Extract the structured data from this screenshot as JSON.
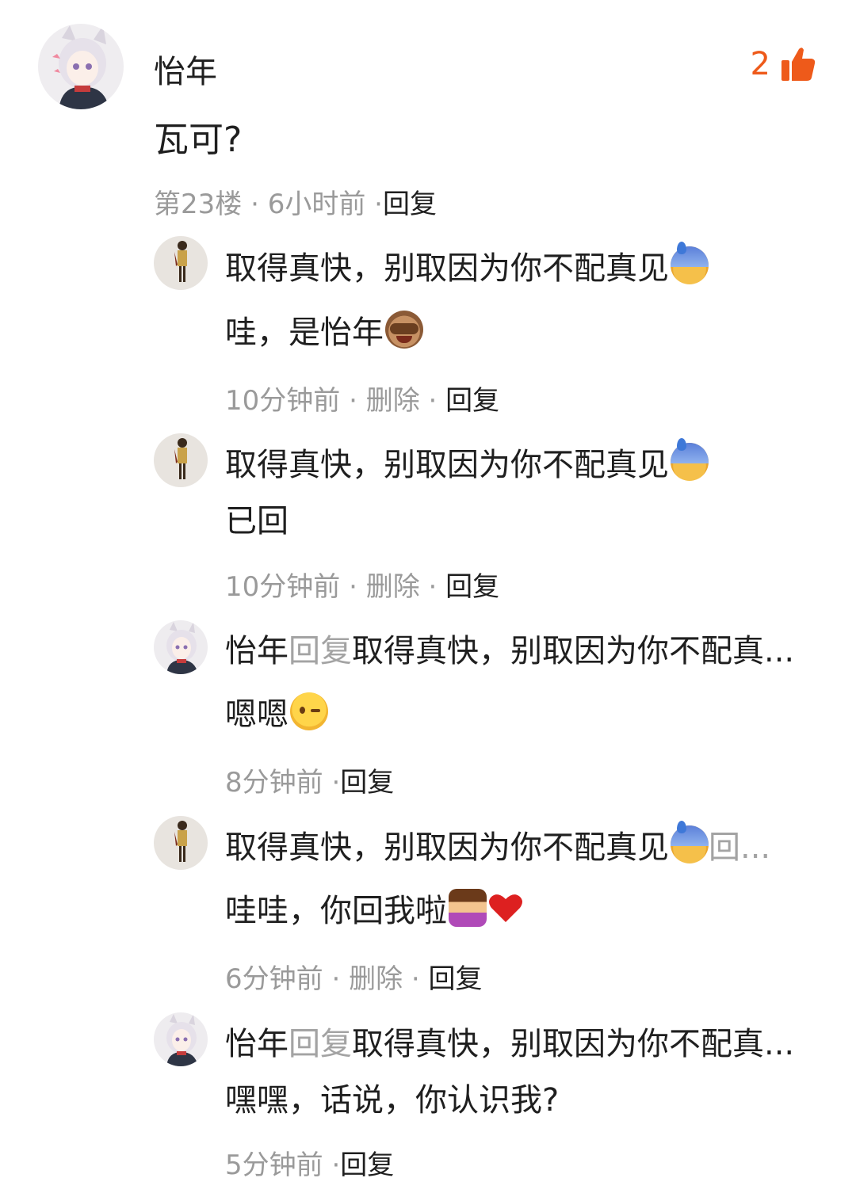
{
  "post": {
    "author": "怡年",
    "text": "瓦可?",
    "like_count": "2",
    "floor": "第23楼",
    "time": "6小时前",
    "reply_label": "回复",
    "avatar_icon": "anime-girl-avatar"
  },
  "separator": " · ",
  "replies": [
    {
      "avatar_icon": "anime-figure-avatar",
      "quote": "取得真快，别取因为你不配真见",
      "quote_emoji": "sweat-face-emoji",
      "text": "哇，是怡年",
      "text_emoji": "see-no-evil-monkey-emoji",
      "time": "10分钟前",
      "delete_label": "删除",
      "reply_label": "回复"
    },
    {
      "avatar_icon": "anime-figure-avatar",
      "quote": "取得真快，别取因为你不配真见",
      "quote_emoji": "sweat-face-emoji",
      "text": "已回",
      "time": "10分钟前",
      "delete_label": "删除",
      "reply_label": "回复"
    },
    {
      "avatar_icon": "anime-girl-avatar",
      "name": "怡年",
      "reply_word": "回复",
      "quote": "取得真快，别取因为你不配真...",
      "text": "嗯嗯",
      "text_emoji": "winking-face-emoji",
      "time": "8分钟前",
      "reply_label": "回复"
    },
    {
      "avatar_icon": "anime-figure-avatar",
      "quote": "取得真快，别取因为你不配真见",
      "quote_emoji": "sweat-face-emoji",
      "quote_tail": "回...",
      "text": "哇哇，你回我啦",
      "text_emoji": "person-gesturing-ok-emoji",
      "text_emoji2": "red-heart-emoji",
      "time": "6分钟前",
      "delete_label": "删除",
      "reply_label": "回复"
    },
    {
      "avatar_icon": "anime-girl-avatar",
      "name": "怡年",
      "reply_word": "回复",
      "quote": "取得真快，别取因为你不配真...",
      "text": "嘿嘿，话说，你认识我?",
      "time": "5分钟前",
      "reply_label": "回复"
    }
  ],
  "colors": {
    "like": "#ee5a1a",
    "meta": "#9a9a9a",
    "text": "#1f1f1f"
  }
}
